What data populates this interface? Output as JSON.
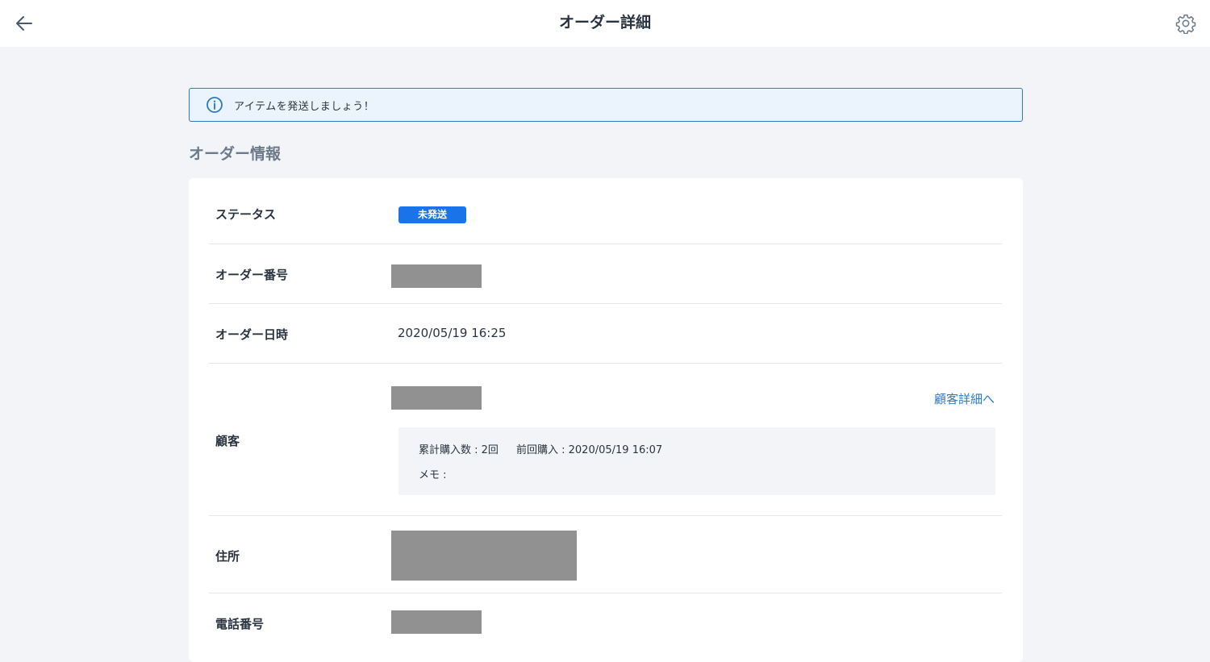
{
  "header": {
    "title": "オーダー詳細",
    "back_icon": "arrow-left-icon",
    "settings_icon": "gear-icon"
  },
  "notice": {
    "icon": "info-icon",
    "text": "アイテムを発送しましょう！",
    "accent_color": "#2d7bc4"
  },
  "section": {
    "title": "オーダー情報"
  },
  "order": {
    "status": {
      "label": "ステータス",
      "value": "未発送",
      "badge_color": "#1a73e8"
    },
    "number": {
      "label": "オーダー番号"
    },
    "date": {
      "label": "オーダー日時",
      "value": "2020/05/19 16:25"
    },
    "customer": {
      "label": "顧客",
      "link_label": "顧客詳細へ",
      "purchase_count": "累計購入数 : 2回",
      "last_purchase": "前回購入 : 2020/05/19 16:07",
      "memo": "メモ :"
    },
    "address": {
      "label": "住所"
    },
    "phone": {
      "label": "電話番号"
    }
  }
}
